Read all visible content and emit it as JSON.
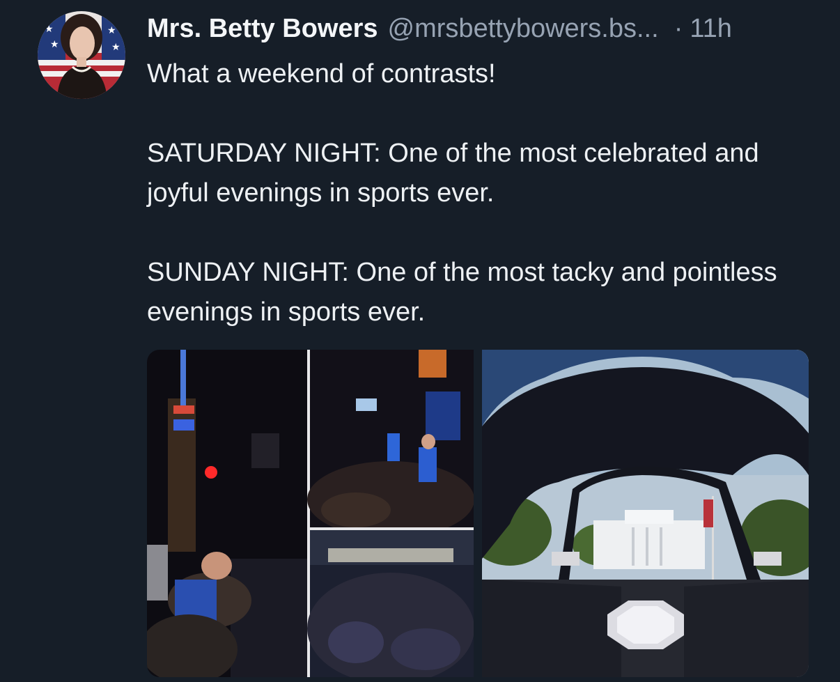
{
  "post": {
    "author_name": "Mrs. Betty Bowers",
    "handle": "@mrsbettybowers.bs...",
    "separator": "·",
    "time": "11h",
    "paragraphs": [
      "What a weekend of contrasts!",
      "SATURDAY NIGHT: One of the most celebrated and joyful evenings in sports ever.",
      "SUNDAY NIGHT: One of the most tacky and pointless evenings in sports ever."
    ]
  },
  "media": [
    {
      "icon": "photo-collage-celebration"
    },
    {
      "icon": "photo-white-house-arena"
    }
  ],
  "colors": {
    "background": "#161e28",
    "text": "#eef1f4",
    "muted": "#97a3b3"
  }
}
